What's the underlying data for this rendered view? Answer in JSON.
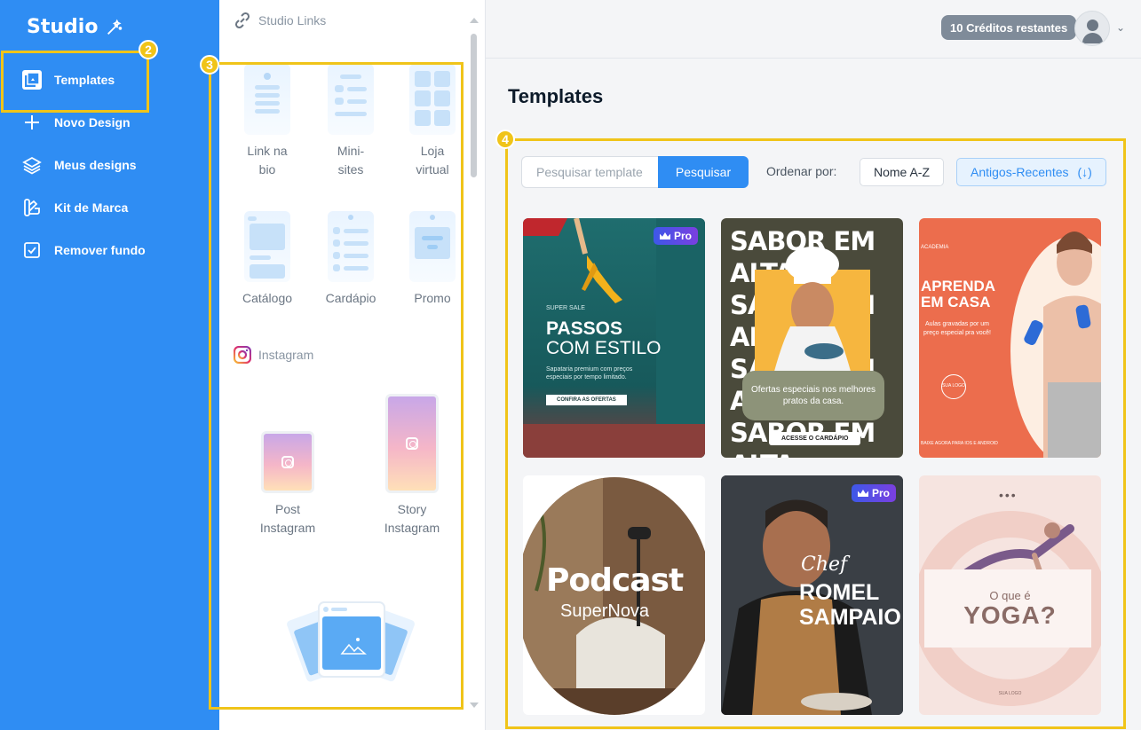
{
  "app": {
    "logo_text": "Studio"
  },
  "sidebar": {
    "items": [
      {
        "label": "Templates",
        "icon": "templates-icon"
      },
      {
        "label": "Novo Design",
        "icon": "plus-icon"
      },
      {
        "label": "Meus designs",
        "icon": "layers-icon"
      },
      {
        "label": "Kit de Marca",
        "icon": "brand-kit-icon"
      },
      {
        "label": "Remover fundo",
        "icon": "remove-bg-icon"
      }
    ]
  },
  "callouts": {
    "sidebar_templates": "2",
    "template_types": "3",
    "template_gallery": "4"
  },
  "panel": {
    "links_section": "Studio Links",
    "links_tiles": [
      {
        "label_1": "Link na",
        "label_2": "bio"
      },
      {
        "label_1": "Mini-",
        "label_2": "sites"
      },
      {
        "label_1": "Loja",
        "label_2": "virtual"
      },
      {
        "label_1": "Catálogo",
        "label_2": ""
      },
      {
        "label_1": "Cardápio",
        "label_2": ""
      },
      {
        "label_1": "Promo",
        "label_2": ""
      }
    ],
    "instagram_section": "Instagram",
    "instagram_tiles": [
      {
        "label_1": "Post",
        "label_2": "Instagram"
      },
      {
        "label_1": "Story",
        "label_2": "Instagram"
      }
    ]
  },
  "topbar": {
    "credits": "10 Créditos restantes"
  },
  "main": {
    "title": "Templates",
    "search": {
      "placeholder": "Pesquisar template",
      "button": "Pesquisar"
    },
    "sort": {
      "label": "Ordenar por:",
      "name_option": "Nome A-Z",
      "date_option": "Antigos-Recentes",
      "date_arrow": "(↓)"
    },
    "pro_label": "Pro",
    "cards": [
      {
        "kicker": "SUPER SALE",
        "title_1": "PASSOS",
        "title_2": "COM ESTILO",
        "desc": "Sapataria premium com preços especiais por tempo limitado.",
        "cta": "CONFIRA AS OFERTAS",
        "pro": true
      },
      {
        "headline": "SABOR EM ALTA",
        "caption": "Ofertas especiais nos melhores pratos da casa.",
        "cta": "ACESSE O CARDÁPIO",
        "pro": false
      },
      {
        "brand": "ACADEMIA",
        "title_1": "APRENDA",
        "title_2": "EM CASA",
        "desc": "Aulas gravadas por um preço especial pra você!",
        "logo": "SUA LOGO",
        "footer": "BAIXE AGORA PARA IOS E ANDROID",
        "pro": false
      },
      {
        "title_1": "Podcast",
        "title_2": "SuperNova",
        "pro": false
      },
      {
        "script": "Chef",
        "title_1": "ROMEL",
        "title_2": "SAMPAIO",
        "pro": true
      },
      {
        "dots": "•••",
        "kicker": "O que é",
        "title": "YOGA?",
        "logo": "SUA LOGO",
        "pro": false
      }
    ]
  },
  "colors": {
    "sidebar": "#2f8df3",
    "accent": "#2f8df3",
    "callout": "#f0c419",
    "pro_gradient": "#3d58e8"
  }
}
